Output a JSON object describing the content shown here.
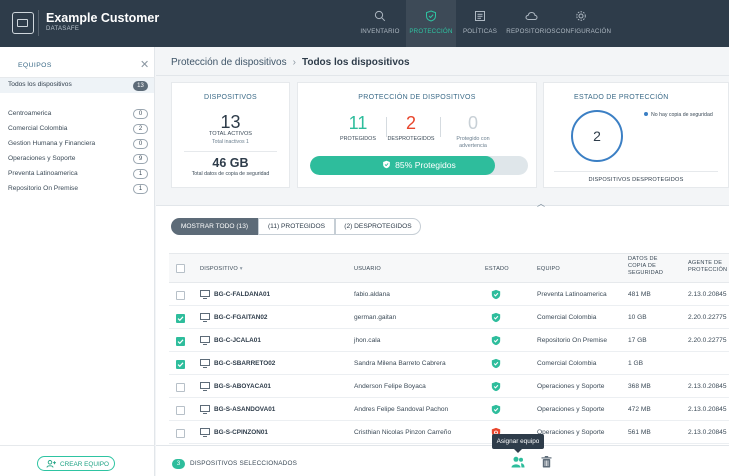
{
  "header": {
    "customer_name": "Example Customer",
    "product": "DATASAFE",
    "nav": [
      {
        "label": "INVENTARIO",
        "icon": "search-icon",
        "active": false
      },
      {
        "label": "PROTECCIÓN",
        "icon": "shield-check-icon",
        "active": true
      },
      {
        "label": "POLÍTICAS",
        "icon": "policy-list-icon",
        "active": false
      },
      {
        "label": "REPOSITORIOS",
        "icon": "cloud-icon",
        "active": false
      },
      {
        "label": "CONFIGURACIÓN",
        "icon": "gear-icon",
        "active": false
      }
    ]
  },
  "sidebar": {
    "title": "EQUIPOS",
    "all_label": "Todos los dispositivos",
    "all_count": "13",
    "items": [
      {
        "label": "Centroamerica",
        "count": "0"
      },
      {
        "label": "Comercial Colombia",
        "count": "2"
      },
      {
        "label": "Gestion Humana y Financiera",
        "count": "0"
      },
      {
        "label": "Operaciones y Soporte",
        "count": "9"
      },
      {
        "label": "Preventa Latinoamerica",
        "count": "1"
      },
      {
        "label": "Repositorio On Premise",
        "count": "1"
      }
    ],
    "create_button": "CREAR EQUIPO"
  },
  "breadcrumb": {
    "parent": "Protección de dispositivos",
    "current": "Todos los dispositivos"
  },
  "card_devices": {
    "title": "DISPOSITIVOS",
    "total": "13",
    "total_label": "TOTAL ACTIVOS",
    "inactive_label": "Total inactivos 1",
    "size": "46 GB",
    "size_label": "Total datos de copia de seguridad"
  },
  "card_protection": {
    "title": "PROTECCIÓN DE DISPOSITIVOS",
    "protected": "11",
    "protected_label": "PROTEGIDOS",
    "unprotected": "2",
    "unprotected_label": "DESPROTEGIDOS",
    "warning": "0",
    "warning_label": "Protegido con advertencia",
    "progress_text": "85% Protegidos",
    "progress_value": 0.85
  },
  "card_state": {
    "title": "ESTADO DE PROTECCIÓN",
    "ring_value": "2",
    "legend": "No hay copia de seguridad",
    "footer": "DISPOSITIVOS DESPROTEGIDOS"
  },
  "filters": [
    "MOSTRAR TODO (13)",
    "(11) PROTEGIDOS",
    "(2) DESPROTEGIDOS"
  ],
  "table": {
    "headers": {
      "device": "DISPOSITIVO",
      "user": "USUARIO",
      "state": "ESTADO",
      "team": "EQUIPO",
      "backup": "DATOS DE COPIA DE SEGURIDAD",
      "agent": "AGENTE DE PROTECCIÓN"
    },
    "rows": [
      {
        "device": "BG-C-FALDANA01",
        "user": "fabio.aldana",
        "status": "ok",
        "team": "Preventa Latinoamerica",
        "backup": "481 MB",
        "agent": "2.13.0.20845",
        "checked": false
      },
      {
        "device": "BG-C-FGAITAN02",
        "user": "german.gaitan",
        "status": "ok",
        "team": "Comercial Colombia",
        "backup": "10 GB",
        "agent": "2.20.0.22775",
        "checked": true
      },
      {
        "device": "BG-C-JCALA01",
        "user": "jhon.cala",
        "status": "ok",
        "team": "Repositorio On Premise",
        "backup": "17 GB",
        "agent": "2.20.0.22775",
        "checked": true
      },
      {
        "device": "BG-C-SBARRETO02",
        "user": "Sandra Milena Barreto Cabrera",
        "status": "ok",
        "team": "Comercial Colombia",
        "backup": "1 GB",
        "agent": "",
        "checked": true
      },
      {
        "device": "BG-S-ABOYACA01",
        "user": "Anderson Felipe Boyaca",
        "status": "ok",
        "team": "Operaciones y Soporte",
        "backup": "368 MB",
        "agent": "2.13.0.20845",
        "checked": false
      },
      {
        "device": "BG-S-ASANDOVA01",
        "user": "Andres Felipe Sandoval Pachon",
        "status": "ok",
        "team": "Operaciones y Soporte",
        "backup": "472 MB",
        "agent": "2.13.0.20845",
        "checked": false
      },
      {
        "device": "BG-S-CPINZON01",
        "user": "Cristhian Nicolas Pinzon Carreño",
        "status": "alert",
        "team": "Operaciones y Soporte",
        "backup": "561 MB",
        "agent": "2.13.0.20845",
        "checked": false
      }
    ]
  },
  "bottom": {
    "selected_count": "3",
    "selected_label": "DISPOSITIVOS SELECCIONADOS",
    "tooltip": "Asignar equipo"
  },
  "colors": {
    "accent": "#2ebd9c",
    "danger": "#e8452c",
    "nav_bg": "#2e3c4a",
    "ring": "#3b7fc4"
  }
}
